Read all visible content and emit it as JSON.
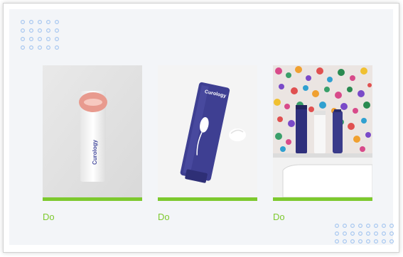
{
  "colors": {
    "accent_green": "#7dc92e",
    "dot_blue": "#a8c8f0",
    "panel_bg": "#f3f5f8"
  },
  "cards": [
    {
      "label": "Do",
      "image": "white tube with lipstick kiss mark, brand text Curology"
    },
    {
      "label": "Do",
      "image": "purple tube with cream swatch, brand text Curology"
    },
    {
      "label": "Do",
      "image": "three products on a counter with colourful confetti wall"
    }
  ],
  "brand_text": "Curology",
  "decor": {
    "top_dots_icon": "dot-grid-icon",
    "bottom_dots_icon": "dot-grid-icon"
  }
}
